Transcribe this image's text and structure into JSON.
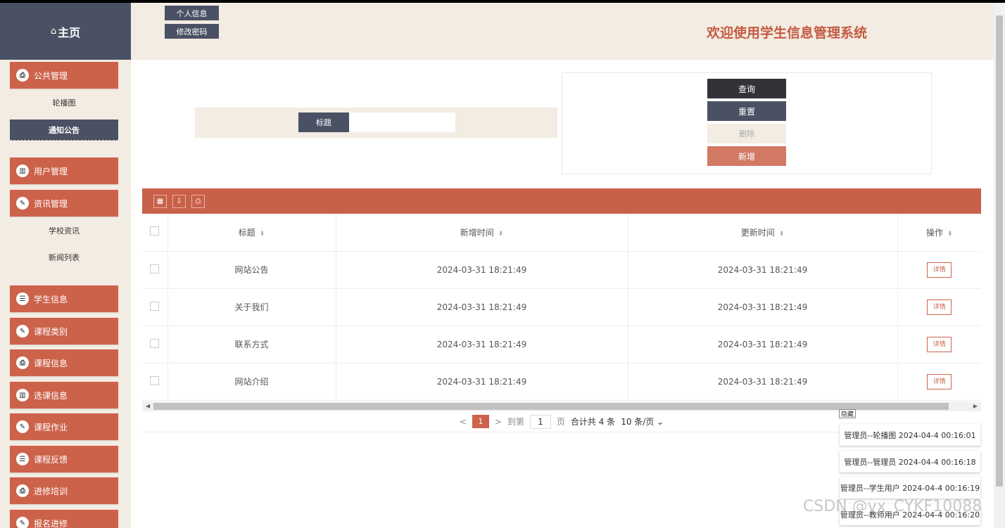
{
  "sidebar": {
    "home": "主页",
    "items": [
      {
        "label": "公共管理",
        "icon": "printer-icon"
      },
      {
        "label": "用户管理",
        "icon": "bar-chart-icon"
      },
      {
        "label": "资讯管理",
        "icon": "edit-icon"
      },
      {
        "label": "学生信息",
        "icon": "document-icon"
      },
      {
        "label": "课程类别",
        "icon": "edit-icon"
      },
      {
        "label": "课程信息",
        "icon": "printer-icon"
      },
      {
        "label": "选课信息",
        "icon": "bar-chart-icon"
      },
      {
        "label": "课程作业",
        "icon": "edit-icon"
      },
      {
        "label": "课程反馈",
        "icon": "document-icon"
      },
      {
        "label": "进修培训",
        "icon": "printer-icon"
      },
      {
        "label": "报名进修",
        "icon": "edit-icon"
      }
    ],
    "sub_public": [
      "轮播图",
      "通知公告"
    ],
    "sub_news": [
      "学校资讯",
      "新闻列表"
    ]
  },
  "header": {
    "profile_button": "个人信息",
    "password_button": "修改密码",
    "welcome": "欢迎使用学生信息管理系统"
  },
  "search": {
    "label": "标题",
    "value": ""
  },
  "actions": {
    "query": "查询",
    "reset": "重置",
    "delete": "删除",
    "add": "新增"
  },
  "table": {
    "columns": [
      "标题",
      "新增时间",
      "更新时间",
      "操作"
    ],
    "rows": [
      {
        "title": "网站公告",
        "created": "2024-03-31 18:21:49",
        "updated": "2024-03-31 18:21:49",
        "action": "详情"
      },
      {
        "title": "关于我们",
        "created": "2024-03-31 18:21:49",
        "updated": "2024-03-31 18:21:49",
        "action": "详情"
      },
      {
        "title": "联系方式",
        "created": "2024-03-31 18:21:49",
        "updated": "2024-03-31 18:21:49",
        "action": "详情"
      },
      {
        "title": "网站介绍",
        "created": "2024-03-31 18:21:49",
        "updated": "2024-03-31 18:21:49",
        "action": "详情"
      }
    ]
  },
  "pager": {
    "prev": "<",
    "current": "1",
    "next": ">",
    "goto": "到第",
    "page_input": "1",
    "page_unit": "页",
    "total": "合计共 4 条",
    "page_size": "10 条/页"
  },
  "log": {
    "hide": "隐藏",
    "entries": [
      "管理员--轮播图 2024-04-4 00:16:01",
      "管理员--管理员 2024-04-4 00:16:18",
      "管理员--学生用户 2024-04-4 00:16:19",
      "管理员--教师用户 2024-04-4 00:16:20"
    ]
  },
  "watermark": "CSDN @vx_CYKF10088"
}
